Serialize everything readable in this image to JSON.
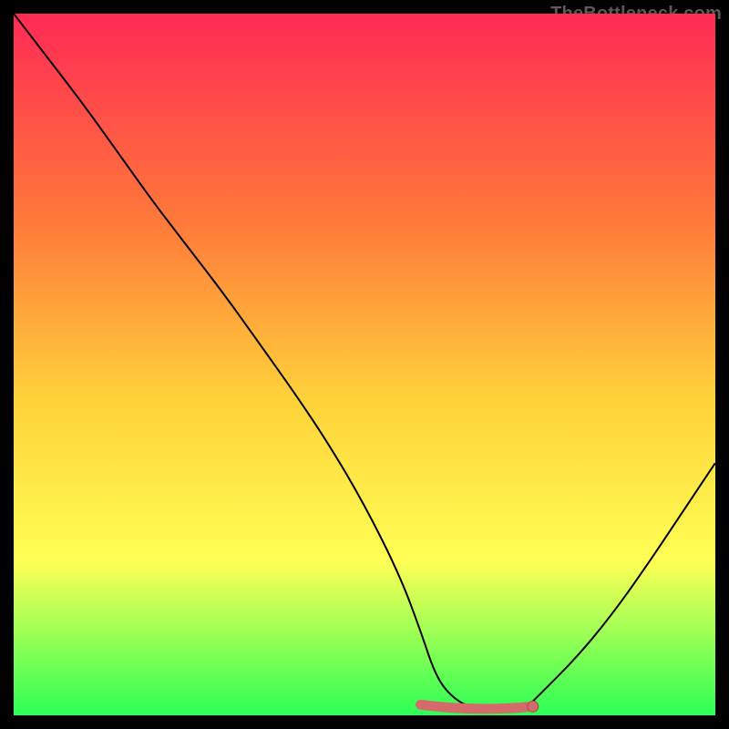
{
  "watermark": "TheBottleneck.com",
  "colors": {
    "gradient_top": "#ff2a55",
    "gradient_mid1": "#ff7a3a",
    "gradient_mid2": "#ffd23a",
    "gradient_mid3": "#ffff55",
    "gradient_bottom": "#2cff55",
    "curve": "#000000",
    "marker_fill": "#d46a6a",
    "marker_stroke": "#a84848"
  },
  "chart_data": {
    "type": "line",
    "title": "",
    "xlabel": "",
    "ylabel": "",
    "xlim": [
      0,
      100
    ],
    "ylim": [
      0,
      100
    ],
    "grid": false,
    "legend": false,
    "series": [
      {
        "name": "bottleneck-curve",
        "x": [
          0,
          5,
          10,
          15,
          20,
          25,
          30,
          35,
          40,
          45,
          50,
          55,
          58,
          60,
          62,
          65,
          70,
          73,
          75,
          80,
          85,
          90,
          95,
          100
        ],
        "y": [
          100,
          93.5,
          87,
          80,
          73,
          66.5,
          60,
          53,
          46,
          38.5,
          30,
          20,
          12,
          6,
          3,
          1,
          0.5,
          1,
          3,
          8,
          14,
          21,
          28.5,
          36
        ]
      }
    ],
    "highlight": {
      "name": "bottleneck-min-region",
      "x_range": [
        58,
        74
      ],
      "approx_y": 1
    }
  }
}
